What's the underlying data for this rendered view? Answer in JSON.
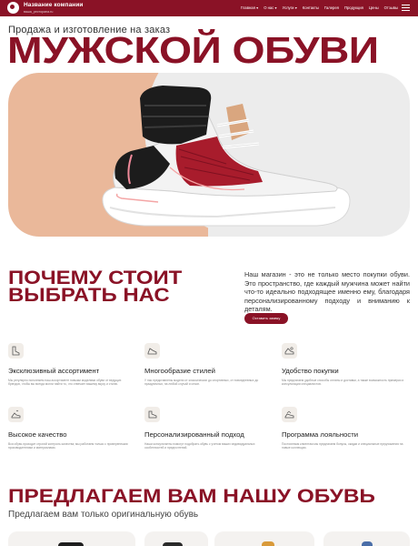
{
  "header": {
    "company_name": "Название компании",
    "company_tagline": "вашa_ресторана.ru",
    "nav": [
      {
        "label": "Главная",
        "caret": "▾"
      },
      {
        "label": "О нас",
        "caret": "▾"
      },
      {
        "label": "Услуги",
        "caret": "▾"
      },
      {
        "label": "Контакты",
        "caret": ""
      },
      {
        "label": "Галерея",
        "caret": ""
      },
      {
        "label": "Продукция",
        "caret": ""
      },
      {
        "label": "Цены",
        "caret": ""
      },
      {
        "label": "Отзывы",
        "caret": ""
      }
    ]
  },
  "hero": {
    "subtitle": "Продажа и изготовление на заказ",
    "title": "МУЖСКОЙ ОБУВИ"
  },
  "why": {
    "title_line1": "ПОЧЕМУ СТОИТ",
    "title_line2": "ВЫБРАТЬ НАС",
    "text": "Наш магазин - это не только место покупки обуви. Это пространство, где каждый мужчина может найти что-то идеально подходящее именно ему, благодаря персонализированному подходу и вниманию к деталям.",
    "button_label": "Оставить заявку"
  },
  "features": [
    {
      "title": "Эксклюзивный ассортимент",
      "icon": "boot-icon",
      "desc": "Мы регулярно пополняем наш ассортимент новыми моделями обуви от ведущих брендов, чтобы вы всегда могли найти то, что отвечает вашему вкусу и стилю."
    },
    {
      "title": "Многообразие стилей",
      "icon": "sneaker-icon",
      "desc": "У нас представлены модели от классических до спортивных, от повседневных до праздничных, на любой случай и сезон."
    },
    {
      "title": "Удобство покупки",
      "icon": "cart-shoe-icon",
      "desc": "Мы предлагаем удобные способы оплаты и доставки, а также возможность примерки и консультации специалистов."
    },
    {
      "title": "Высокое качество",
      "icon": "quality-shoe-icon",
      "desc": "Вся обувь проходит строгий контроль качества, мы работаем только с проверенными производителями и материалами."
    },
    {
      "title": "Персонализированный подход",
      "icon": "heel-shoe-icon",
      "desc": "Наши консультанты помогут подобрать обувь с учетом ваших индивидуальных особенностей и предпочтений."
    },
    {
      "title": "Программа лояльности",
      "icon": "loyalty-shoe-icon",
      "desc": "Постоянным клиентам мы предлагаем бонусы, скидки и специальные предложения на новые коллекции."
    }
  ],
  "offer": {
    "title": "ПРЕДЛАГАЕМ ВАМ НАШУ ОБУВЬ",
    "subtitle": "Предлагаем вам только оригинальную обувь"
  },
  "colors": {
    "brand": "#8a1226",
    "hero_accent": "#eab89a",
    "hero_bg": "#ececec"
  }
}
